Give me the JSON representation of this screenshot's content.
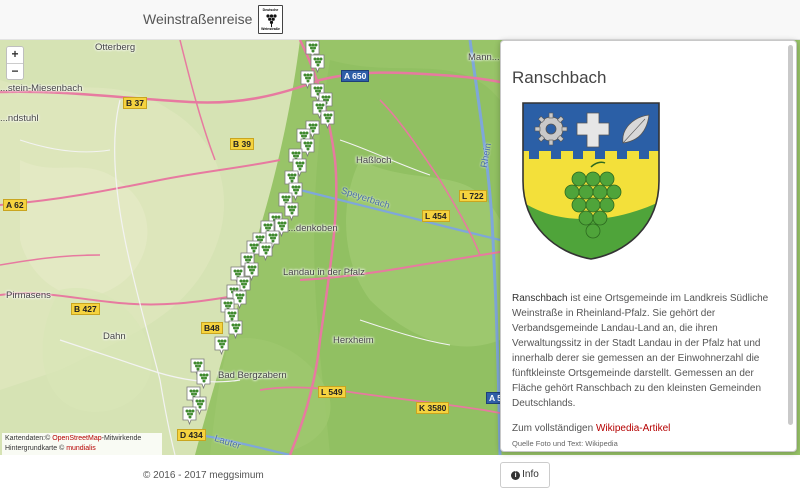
{
  "navbar": {
    "brand": "Weinstraßenreise",
    "logo_text_top": "Deutsche",
    "logo_text_bottom": "Weinstraße"
  },
  "map": {
    "zoom_in": "+",
    "zoom_out": "−",
    "places": [
      "Otterberg",
      "...stein-Miesenbach",
      "...ndstuhl",
      "Haßloch",
      "Speyerbach",
      "...denkoben",
      "Landau in der Pfalz",
      "Herxheim",
      "Pirmasens",
      "Dahn",
      "Bad Bergzabern",
      "Rhein",
      "Lauter",
      "Mann..."
    ],
    "roads": [
      "A 650",
      "B 37",
      "B 39",
      "A 62",
      "L 722",
      "L 454",
      "B 427",
      "B48",
      "L 549",
      "K 3580",
      "D 434",
      "A 5"
    ],
    "attribution": {
      "line1_prefix": "Kartendaten:© ",
      "line1_link": "OpenStreetMap",
      "line1_suffix": "-Mitwirkende",
      "line2_prefix": "Hintergrundkarte © ",
      "line2_link": "mundialis"
    }
  },
  "panel": {
    "title": "Ranschbach",
    "description_highlight": "Ranschbach",
    "description": " ist eine Ortsgemeinde im Landkreis Südliche Weinstraße in Rheinland-Pfalz. Sie gehört der Verbandsgemeinde Landau-Land an, die ihren Verwaltungssitz in der Stadt Landau in der Pfalz hat und innerhalb derer sie gemessen an der Einwohnerzahl die fünftkleinste Ortsgemeinde darstellt. Gemessen an der Fläche gehört Ranschbach zu den kleinsten Gemeinden Deutschlands.",
    "more_prefix": "Zum vollständigen ",
    "more_link": "Wikipedia-Artikel",
    "source": "Quelle Foto und Text: Wikipedia"
  },
  "footer": {
    "copyright": "© 2016 - 2017 meggsimum",
    "info_button": "Info"
  },
  "colors": {
    "link": "#b50000",
    "coat_blue": "#2b5fa6",
    "coat_yellow": "#f3e03a",
    "coat_green": "#4fa43a"
  }
}
